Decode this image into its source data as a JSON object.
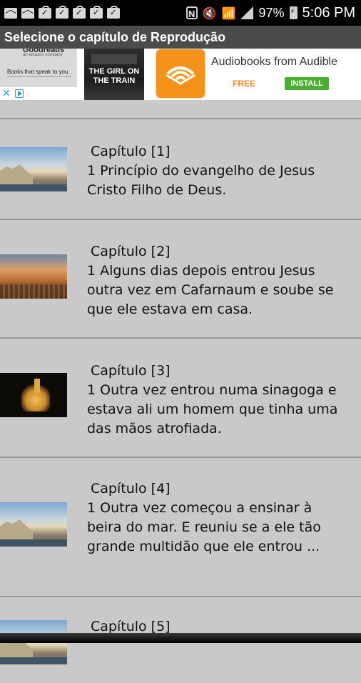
{
  "status_bar": {
    "battery_percent": "97%",
    "time": "5:06 PM"
  },
  "title_bar": {
    "title": "Selecione o capítulo de Reprodução"
  },
  "ad": {
    "left_brand": "Goodreads",
    "left_brand_sub": "an amazon company",
    "left_tagline": "Books that speak to you",
    "book_cover_title": "THE GIRL ON THE TRAIN",
    "title": "Audiobooks from Audible",
    "price": "FREE",
    "install_label": "INSTALL",
    "accent_color": "#f4921a",
    "install_color": "#4caf34"
  },
  "chapters": [
    {
      "heading": "Capítulo [1]",
      "text": "1 Princípio do evangelho de Jesus Cristo  Filho de Deus.",
      "thumbnail": "coastal-city-image"
    },
    {
      "heading": "Capítulo [2]",
      "text": "1 Alguns dias depois entrou Jesus outra vez em Cafarnaum  e soube se que ele estava em casa.",
      "thumbnail": "city-sunset-image"
    },
    {
      "heading": "Capítulo [3]",
      "text": "1 Outra vez entrou numa sinagoga e estava ali um homem que tinha uma das mãos atrofiada.",
      "thumbnail": "night-building-image"
    },
    {
      "heading": "Capítulo [4]",
      "text": "1 Outra vez começou a ensinar à beira do mar. E reuniu se a ele tão grande multidão que ele entrou ...",
      "thumbnail": "coastal-city-image"
    },
    {
      "heading": "Capítulo [5]",
      "text": "",
      "thumbnail": "coastal-city-image"
    }
  ]
}
